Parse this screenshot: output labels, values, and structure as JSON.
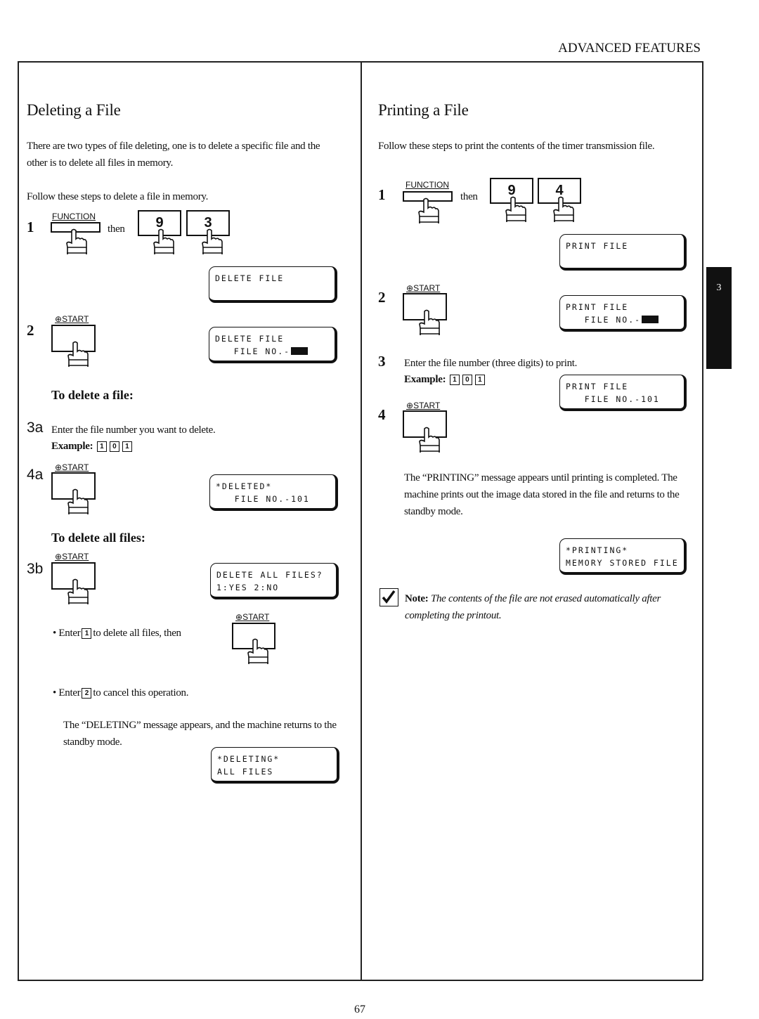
{
  "header": {
    "section": "ADVANCED FEATURES",
    "page_number": "67",
    "chapter_tab": "3"
  },
  "left": {
    "title": "Deleting a File",
    "intro": "There are two types of file deleting, one is to delete a specific file and the other is to delete all files in memory.",
    "follow": "Follow these steps to delete a file in memory.",
    "step1": {
      "num": "1",
      "function_label": "FUNCTION",
      "then": "then",
      "key_a": "9",
      "key_b": "3",
      "lcd": "DELETE FILE"
    },
    "step2": {
      "num": "2",
      "start_label": "START",
      "lcd_line1": "DELETE FILE",
      "lcd_line2": "   FILE NO.-"
    },
    "sub1": "To delete a file:",
    "step3a": {
      "num": "3a",
      "text": "Enter the file number you want to delete.",
      "example": "Example:",
      "keys": [
        "1",
        "0",
        "1"
      ]
    },
    "step4a": {
      "num": "4a",
      "start_label": "START",
      "lcd_line1": "*DELETED*",
      "lcd_line2": "   FILE NO.-101"
    },
    "sub2": "To delete all files:",
    "step3b": {
      "num": "3b",
      "start_label": "START",
      "lcd_line1": "DELETE ALL FILES?",
      "lcd_line2": "1:YES 2:NO"
    },
    "bullet1": {
      "pre": "Enter",
      "key": "1",
      "post": "to delete all files, then",
      "start_label": "START"
    },
    "bullet2": {
      "pre": "Enter",
      "key": "2",
      "post": "to cancel this operation."
    },
    "closing": "The “DELETING” message appears, and the machine returns to the standby mode.",
    "final_lcd": {
      "line1": "*DELETING*",
      "line2": "ALL FILES"
    }
  },
  "right": {
    "title": "Printing a File",
    "intro": "Follow these steps to print the contents of the timer transmission file.",
    "step1": {
      "num": "1",
      "function_label": "FUNCTION",
      "then": "then",
      "key_a": "9",
      "key_b": "4",
      "lcd": "PRINT FILE"
    },
    "step2": {
      "num": "2",
      "start_label": "START",
      "lcd_line1": "PRINT FILE",
      "lcd_line2": "   FILE NO.-"
    },
    "step3": {
      "num": "3",
      "text": "Enter the file number (three digits) to print.",
      "example": "Example:",
      "keys": [
        "1",
        "0",
        "1"
      ],
      "lcd_line1": "PRINT FILE",
      "lcd_line2": "   FILE NO.-101"
    },
    "step4": {
      "num": "4",
      "start_label": "START"
    },
    "closing": "The “PRINTING” message appears until printing is completed.  The machine prints out the image data stored in the file and returns to the standby mode.",
    "final_lcd": {
      "line1": "*PRINTING*",
      "line2": "MEMORY STORED FILE"
    },
    "note": {
      "label": "Note:",
      "text": "The contents of the file are not erased automatically after completing the printout.",
      "icon": "checkmark-icon"
    }
  }
}
